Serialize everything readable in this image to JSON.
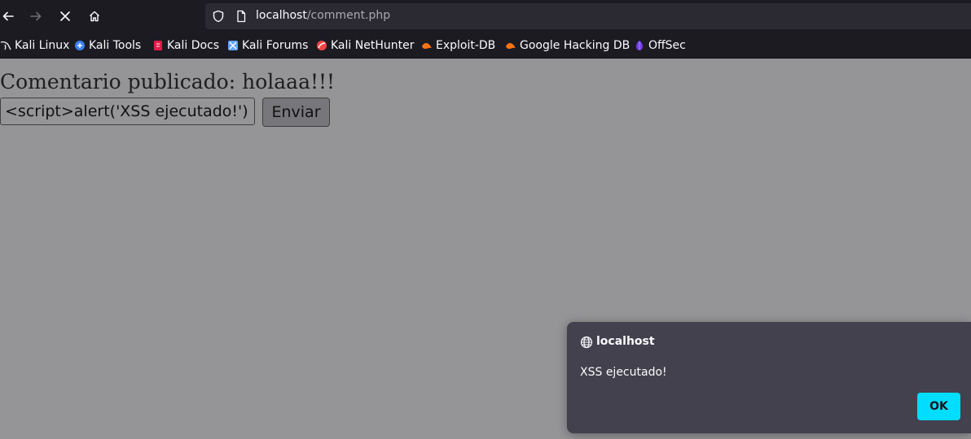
{
  "browser": {
    "url": {
      "host": "localhost",
      "path": "/comment.php"
    },
    "nav": {
      "back_icon": "arrow-left-icon",
      "forward_icon": "arrow-right-icon",
      "stop_icon": "close-icon",
      "home_icon": "home-icon"
    }
  },
  "bookmarks": [
    {
      "label": "Kali Linux",
      "icon": "kali-dragon-icon",
      "color": "#e8e8e8"
    },
    {
      "label": "Kali Tools",
      "icon": "kali-tools-icon",
      "color": "#3b82f6"
    },
    {
      "label": "Kali Docs",
      "icon": "kali-docs-icon",
      "color": "#e11d48"
    },
    {
      "label": "Kali Forums",
      "icon": "kali-forums-icon",
      "color": "#60a5fa"
    },
    {
      "label": "Kali NetHunter",
      "icon": "kali-nethunter-icon",
      "color": "#ef4444"
    },
    {
      "label": "Exploit-DB",
      "icon": "exploit-db-icon",
      "color": "#f97316"
    },
    {
      "label": "Google Hacking DB",
      "icon": "ghdb-icon",
      "color": "#f97316"
    },
    {
      "label": "OffSec",
      "icon": "offsec-icon",
      "color": "#7c3aed"
    }
  ],
  "page": {
    "heading": "Comentario publicado: holaaa!!!",
    "comment_input_value": "<script>alert('XSS ejecutado!')",
    "submit_label": "Enviar"
  },
  "dialog": {
    "origin": "localhost",
    "message": "XSS ejecutado!",
    "ok_label": "OK"
  },
  "colors": {
    "chrome": "#1c1b22",
    "page_background": "#959497",
    "dialog_background": "#42414d",
    "accent": "#00ddff"
  }
}
